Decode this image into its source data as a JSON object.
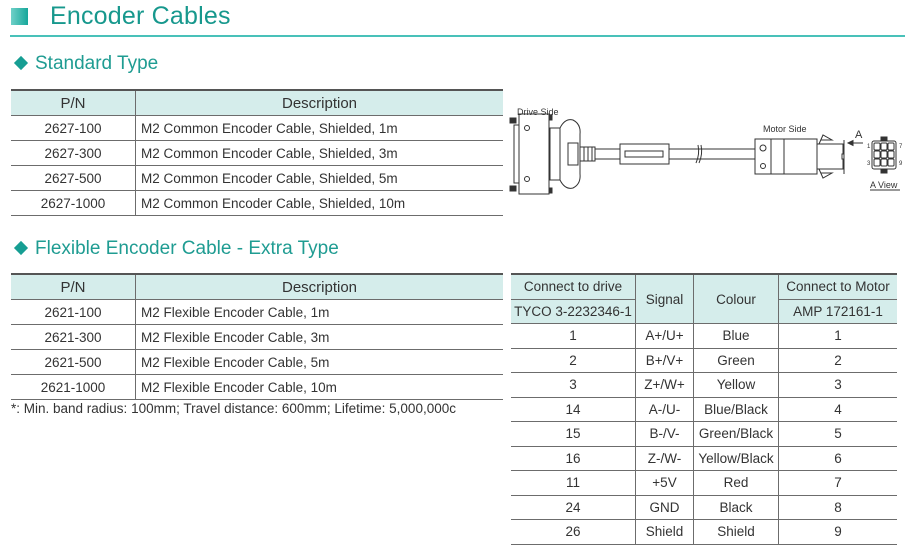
{
  "page": {
    "title": "Encoder Cables",
    "accent_color": "#17988d",
    "header_bg_color": "#d5edeb"
  },
  "standard": {
    "heading": "Standard Type",
    "columns": [
      "P/N",
      "Description"
    ],
    "rows": [
      {
        "pn": "2627-100",
        "desc": "M2 Common Encoder Cable, Shielded, 1m"
      },
      {
        "pn": "2627-300",
        "desc": "M2 Common Encoder Cable, Shielded, 3m"
      },
      {
        "pn": "2627-500",
        "desc": "M2 Common Encoder Cable, Shielded, 5m"
      },
      {
        "pn": "2627-1000",
        "desc": "M2 Common Encoder Cable, Shielded, 10m"
      }
    ]
  },
  "flexible": {
    "heading": "Flexible Encoder Cable - Extra Type",
    "columns": [
      "P/N",
      "Description"
    ],
    "rows": [
      {
        "pn": "2621-100",
        "desc": "M2 Flexible Encoder Cable, 1m"
      },
      {
        "pn": "2621-300",
        "desc": "M2 Flexible Encoder Cable, 3m"
      },
      {
        "pn": "2621-500",
        "desc": "M2 Flexible Encoder Cable, 5m"
      },
      {
        "pn": "2621-1000",
        "desc": "M2 Flexible Encoder Cable, 10m"
      }
    ],
    "note": "*: Min. band radius: 100mm; Travel distance: 600mm; Lifetime: 5,000,000c"
  },
  "diagram": {
    "drive_label": "Drive Side",
    "motor_label": "Motor Side",
    "arrow_label": "A",
    "view_label": "A View",
    "pin_labels": [
      "1",
      "7",
      "3",
      "9"
    ]
  },
  "pinout": {
    "headers": {
      "drive": "Connect to drive",
      "drive_part": "TYCO 3-2232346-1",
      "signal": "Signal",
      "colour": "Colour",
      "motor": "Connect to Motor",
      "motor_part": "AMP 172161-1"
    },
    "rows": [
      {
        "drive": "1",
        "signal": "A+/U+",
        "colour": "Blue",
        "motor": "1"
      },
      {
        "drive": "2",
        "signal": "B+/V+",
        "colour": "Green",
        "motor": "2"
      },
      {
        "drive": "3",
        "signal": "Z+/W+",
        "colour": "Yellow",
        "motor": "3"
      },
      {
        "drive": "14",
        "signal": "A-/U-",
        "colour": "Blue/Black",
        "motor": "4"
      },
      {
        "drive": "15",
        "signal": "B-/V-",
        "colour": "Green/Black",
        "motor": "5"
      },
      {
        "drive": "16",
        "signal": "Z-/W-",
        "colour": "Yellow/Black",
        "motor": "6"
      },
      {
        "drive": "11",
        "signal": "+5V",
        "colour": "Red",
        "motor": "7"
      },
      {
        "drive": "24",
        "signal": "GND",
        "colour": "Black",
        "motor": "8"
      },
      {
        "drive": "26",
        "signal": "Shield",
        "colour": "Shield",
        "motor": "9"
      }
    ]
  }
}
